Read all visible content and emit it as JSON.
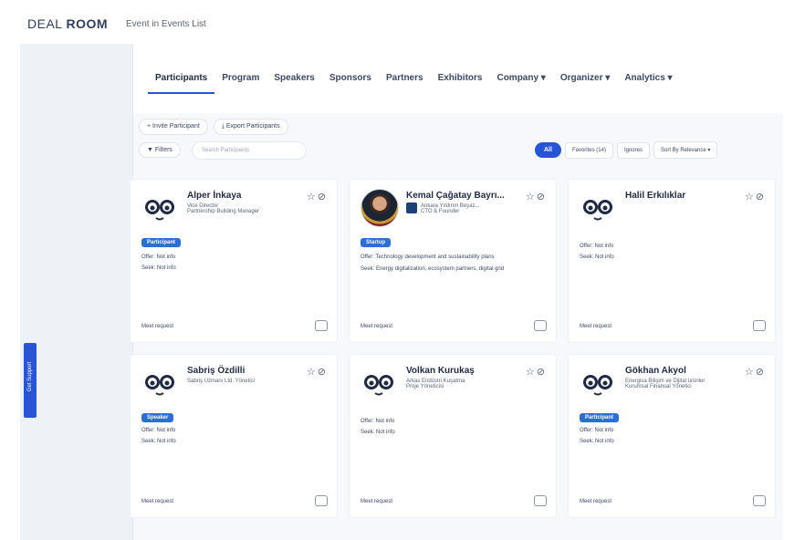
{
  "app": {
    "logo_prefix": "DEAL ",
    "logo_bold": "ROOM",
    "event_title": "Event in Events List"
  },
  "side_tab": "Get Support",
  "nav": {
    "tabs": [
      "Participants",
      "Program",
      "Speakers",
      "Sponsors",
      "Partners",
      "Exhibitors",
      "Company ▾",
      "Organizer ▾",
      "Analytics ▾"
    ],
    "active": "Participants"
  },
  "actions": {
    "invite": "+ Invite Participant",
    "export": "⤓ Export Participants"
  },
  "filters": {
    "filter_label": "▼ Filters",
    "search_placeholder": "Search Participants",
    "seg_all": "All",
    "seg_items": [
      "Favorites (14)",
      "Ignores",
      "Sort By Relevance ▾"
    ]
  },
  "cards": [
    {
      "name": "Alper İnkaya",
      "role": "Vice Director",
      "role2": "Partnership Building Manager",
      "badge": "Participant",
      "offer": "Offer: Not info",
      "seek": "Seek: Not info",
      "meet": "Meet request",
      "photo": false
    },
    {
      "name": "Kemal Çağatay Bayrı...",
      "role": "Ankara Yıldırım Beyaz...",
      "role2": "CTO & Founder",
      "badge": "Startup",
      "offer": "Offer: Technology development and sustainability plans",
      "seek": "Seek: Energy digitalization, ecosystem partners, digital grid",
      "meet": "Meet request",
      "photo": true
    },
    {
      "name": "Halil Erkılıklar",
      "role": "",
      "role2": "",
      "badge": "",
      "offer": "Offer: Not info",
      "seek": "Seek: Not info",
      "meet": "Meet request",
      "photo": false
    },
    {
      "name": "Sabriş Özdilli",
      "role": "Sabriş Uzmanı Ltd. Yönetici",
      "role2": "",
      "badge": "Speaker",
      "offer": "Offer: Not info",
      "seek": "Seek: Not info",
      "meet": "Meet request",
      "photo": false
    },
    {
      "name": "Volkan Kurukaş",
      "role": "Arkas Endüstri Kuşatma",
      "role2": "Proje Yöneticisi",
      "badge": "",
      "offer": "Offer: Not info",
      "seek": "Seek: Not info",
      "meet": "Meet request",
      "photo": false
    },
    {
      "name": "Gökhan Akyol",
      "role": "Energisa Bilişim ve Dijital ürünler",
      "role2": "Kurumsal Finansal Yönetici",
      "badge": "Participant",
      "offer": "Offer: Not info",
      "seek": "Seek: Not info",
      "meet": "Meet request",
      "photo": false
    }
  ]
}
